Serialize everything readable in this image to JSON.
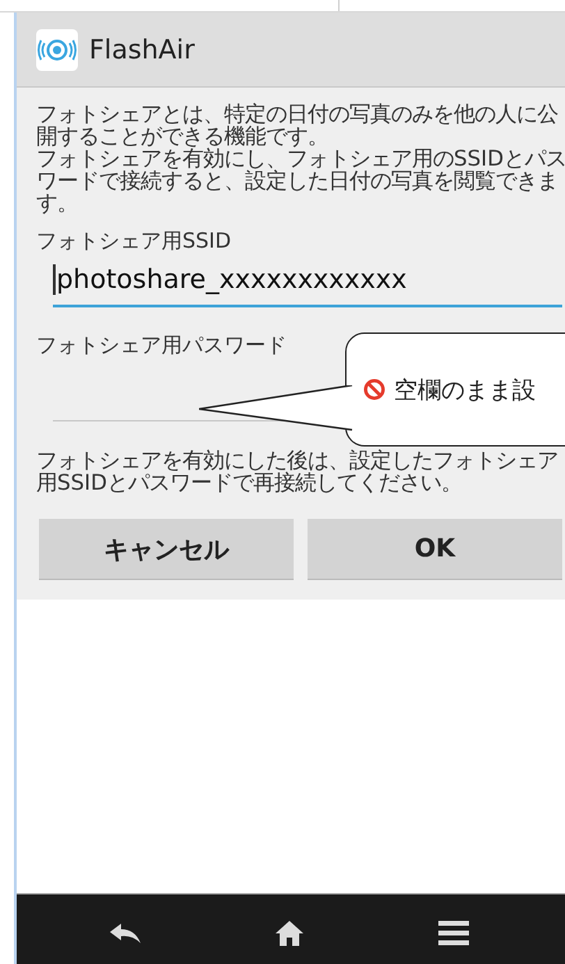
{
  "header": {
    "title": "FlashAir"
  },
  "description": [
    "フォトシェアとは、特定の日付の写真のみを他の人に公開することができる機能です。",
    "フォトシェアを有効にし、フォトシェア用のSSIDとパスワードで接続すると、設定した日付の写真を閲覧できます。"
  ],
  "fields": [
    {
      "label": "フォトシェア用SSID",
      "value": "photoshare_xxxxxxxxxxxx",
      "focused": true
    },
    {
      "label": "フォトシェア用パスワード",
      "focused": false
    }
  ],
  "tooltip": {
    "text": "空欄のまま設"
  },
  "note": "フォトシェアを有効にした後は、設定したフォトシェア用SSIDとパスワードで再接続してください。",
  "buttons": [
    {
      "label": "キャンセル"
    },
    {
      "label": "OK"
    }
  ]
}
